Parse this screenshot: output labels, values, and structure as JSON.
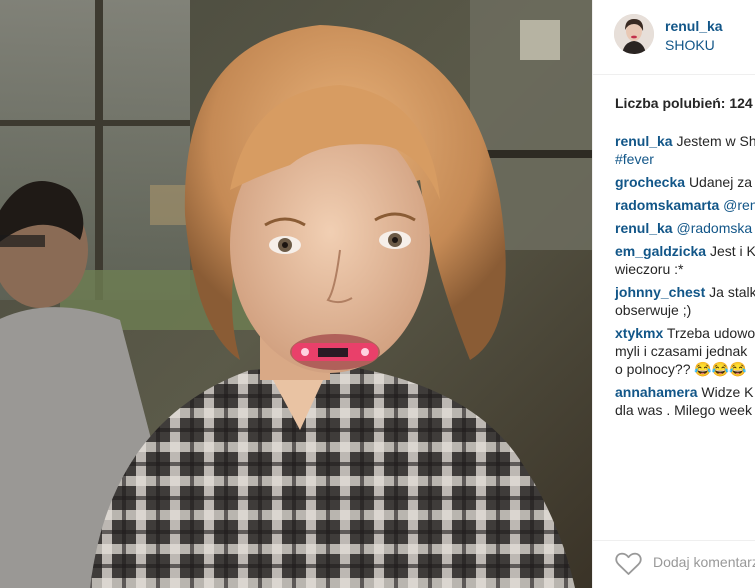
{
  "post": {
    "author": "renul_ka",
    "location": "SHOKU"
  },
  "likes": {
    "text": "Liczba polubień: 124"
  },
  "comments": [
    {
      "author": "renul_ka",
      "lines": [
        "Jestem w Sh"
      ],
      "hashtag": "#fever"
    },
    {
      "author": "grochecka",
      "lines": [
        "Udanej za"
      ]
    },
    {
      "author": "radomskamarta",
      "lines": [
        "@renu"
      ]
    },
    {
      "author": "renul_ka",
      "lines": [
        "@radomska"
      ]
    },
    {
      "author": "em_galdzicka",
      "lines": [
        "Jest i K",
        "wieczoru :*"
      ]
    },
    {
      "author": "johnny_chest",
      "lines": [
        "Ja stalk",
        "obserwuje ;)"
      ]
    },
    {
      "author": "xtykmx",
      "lines": [
        "Trzeba udowo",
        "myli i czasami jednak",
        "o polnocy?? 😂😂😂"
      ]
    },
    {
      "author": "annahamera",
      "lines": [
        "Widze K",
        "dla was . Milego week"
      ]
    }
  ],
  "footer": {
    "add_comment_placeholder": "Dodaj komentarz..."
  },
  "icons": {
    "like": "heart-outline-icon"
  },
  "colors": {
    "link": "#125688",
    "text": "#262626",
    "muted": "#999999"
  }
}
